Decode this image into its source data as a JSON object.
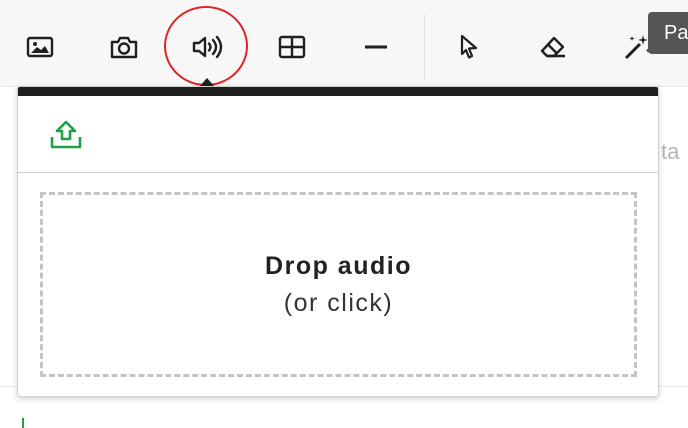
{
  "toolbar": {
    "tools": [
      {
        "name": "image-icon",
        "label": ""
      },
      {
        "name": "camera-icon",
        "label": ""
      },
      {
        "name": "audio-icon",
        "label": ""
      },
      {
        "name": "table-icon",
        "label": ""
      },
      {
        "name": "horizontal-rule-icon",
        "label": ""
      },
      {
        "name": "pointer-icon",
        "label": ""
      },
      {
        "name": "eraser-icon",
        "label": ""
      },
      {
        "name": "magic-wand-icon",
        "label": ""
      }
    ],
    "tooltip": "Pa"
  },
  "background": {
    "partial_text": "ta"
  },
  "audio_panel": {
    "upload_icon": "upload-tray-icon",
    "drop_title": "Drop audio",
    "drop_subtitle": "(or click)"
  },
  "colors": {
    "highlight": "#e02424",
    "upload_icon": "#22a046",
    "panel_bar": "#1f1f1f"
  }
}
